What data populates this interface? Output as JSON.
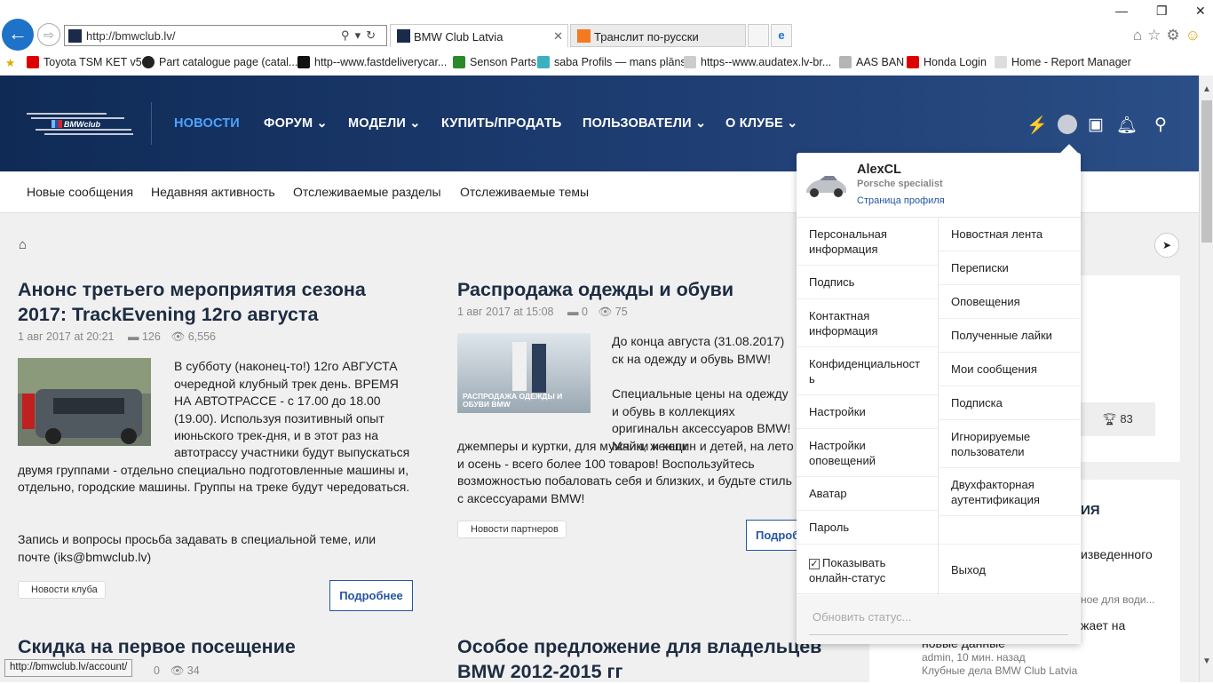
{
  "browser": {
    "url": "http://bmwclub.lv/",
    "tabs": [
      {
        "title": "BMW Club Latvia"
      },
      {
        "title": "Транслит по-русски"
      }
    ],
    "favorites": [
      "Toyota TSM KET v5",
      "Part catalogue page (catal...",
      "http--www.fastdeliverycar...",
      "Senson Parts",
      "saba Profils — mans plāns",
      "https--www.audatex.lv-br...",
      "AAS BAN",
      "Honda Login",
      "Home - Report Manager"
    ],
    "status_url": "http://bmwclub.lv/account/"
  },
  "site": {
    "logo_text": "BMW club",
    "nav": [
      {
        "label": "НОВОСТИ",
        "active": true
      },
      {
        "label": "ФОРУМ ⌄"
      },
      {
        "label": "МОДЕЛИ ⌄"
      },
      {
        "label": "КУПИТЬ/ПРОДАТЬ"
      },
      {
        "label": "ПОЛЬЗОВАТЕЛИ ⌄"
      },
      {
        "label": "О КЛУБЕ ⌄"
      }
    ],
    "subnav": [
      "Новые сообщения",
      "Недавняя активность",
      "Отслеживаемые разделы",
      "Отслеживаемые темы"
    ]
  },
  "articles": [
    {
      "title": "Анонс третьего мероприятия сезона 2017: TrackEvening 12го августа",
      "date": "1 авг 2017 at 20:21",
      "comments": "126",
      "views": "6,556",
      "body": "В субботу (наконец-то!) 12го АВГУСТА очередной клубный трек день. ВРЕМЯ НА АВТОТРАССЕ - с 17.00 до 18.00 (19.00). Используя позитивный опыт июньского трек-дня, и в этот раз на автотрассу участники будут выпускаться двумя группами - отдельно специально подготовленные машины и, отдельно, городские машины. Группы на треке будут чередоваться.",
      "body2": "Запись и вопросы просьба задавать в специальной теме, или почте (iks@bmwclub.lv)",
      "tag": "Новости клуба",
      "more": "Подробнее"
    },
    {
      "title": "Распродажа одежды и обуви",
      "date": "1 авг 2017 at 15:08",
      "comments": "0",
      "views": "75",
      "image_caption": "РАСПРОДАЖА ОДЕЖДЫ И ОБУВИ BMW",
      "body": "До конца августа (31.08.2017) ск на одежду и обувь BMW!",
      "body2": "Специальные цены на одежду и обувь в коллекциях оригинальн аксессуаров BMW! Майки и кепк джемперы и куртки, для мужчин, женщин и детей, на лето и осень - всего более 100 товаров! Воспользуйтесь возможностью побаловать себя и близких, и будьте стиль с аксессуарами BMW!",
      "tag": "Новости партнеров",
      "more": "Подроб"
    },
    {
      "title": "Скидка на первое посещение",
      "comments": "0",
      "views": "34"
    },
    {
      "title": "Особое предложение для владельцев BMW 2012-2015 гг"
    }
  ],
  "sidebar": {
    "trophy": "83",
    "heading_partial": "ИЯ",
    "text1": "изведенного",
    "text2": "ное для води...",
    "text3": "жает на",
    "text4": "новые данные",
    "meta": "admin, 10 мин. назад",
    "meta2": "Клубные дела BMW Club Latvia"
  },
  "account_menu": {
    "username": "AlexCL",
    "user_title": "Porsche specialist",
    "profile_link": "Страница профиля",
    "left": [
      "Персональная информация",
      "Подпись",
      "Контактная информация",
      "Конфиденциальность",
      "Настройки",
      "Настройки оповещений",
      "Аватар",
      "Пароль",
      "Показывать онлайн-статус"
    ],
    "right": [
      "Новостная лента",
      "Переписки",
      "Оповещения",
      "Полученные лайки",
      "Мои сообщения",
      "Подписка",
      "Игнорируемые пользователи",
      "Двухфакторная аутентификация",
      "",
      "Выход"
    ],
    "status_placeholder": "Обновить статус..."
  },
  "colors": {
    "header": "#1a3567",
    "accent": "#4da3ff",
    "link": "#2456a4"
  }
}
